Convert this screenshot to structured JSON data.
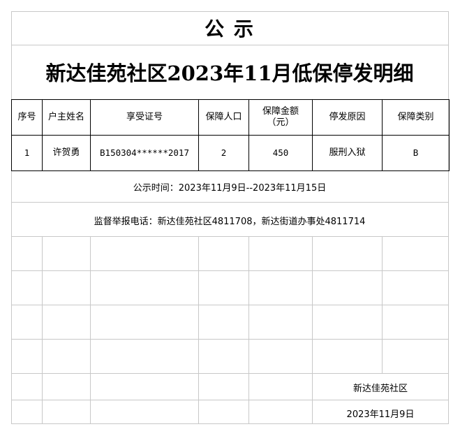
{
  "header": {
    "title": "公 示",
    "subtitle": "新达佳苑社区2023年11月低保停发明细"
  },
  "table": {
    "columns": [
      "序号",
      "户主姓名",
      "享受证号",
      "保障人口",
      "保障金额（元）",
      "停发原因",
      "保障类别"
    ],
    "rows": [
      [
        "1",
        "许贺勇",
        "B150304******2017",
        "2",
        "450",
        "服刑入狱",
        "B"
      ]
    ]
  },
  "notice": {
    "period": "公示时间：2023年11月9日--2023年11月15日",
    "hotline": "监督举报电话：新达佳苑社区4811708，新达街道办事处4811714"
  },
  "footer": {
    "org": "新达佳苑社区",
    "date": "2023年11月9日"
  }
}
